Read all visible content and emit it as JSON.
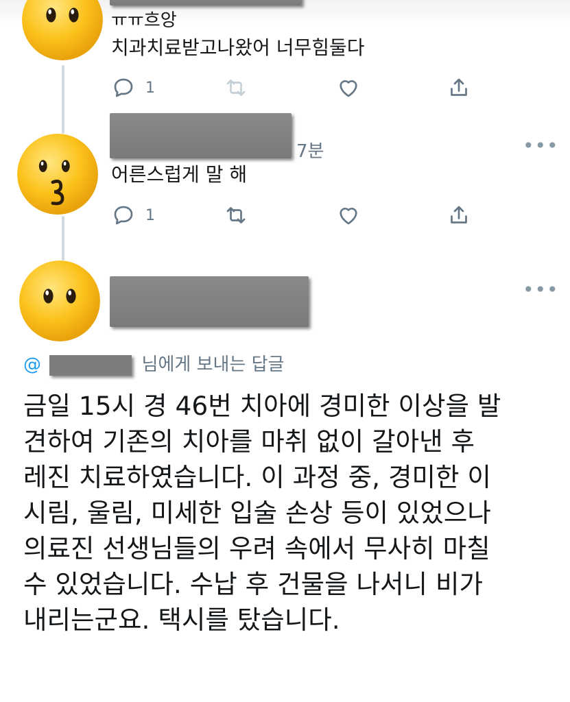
{
  "tweets": [
    {
      "avatar_icon": "emoji-face-neutral-icon",
      "text_lines": [
        "ㅠㅠ흐앙",
        "치과치료받고나왔어 너무힘둘다"
      ],
      "actions": {
        "reply_count": "1",
        "retweet_count": "",
        "like_count": ""
      }
    },
    {
      "avatar_icon": "emoji-face-kissing-icon",
      "time": "7분",
      "text_lines": [
        "어른스럽게 말 해"
      ],
      "actions": {
        "reply_count": "1",
        "retweet_count": "",
        "like_count": ""
      }
    }
  ],
  "focused": {
    "avatar_icon": "emoji-face-neutral-icon",
    "reply_to": {
      "at": "@",
      "suffix": "님에게 보내는 답글"
    },
    "body_lines": [
      "금일 15시 경 46번 치아에 경미한 이상을 발",
      "견하여 기존의 치아를 마취 없이 갈아낸 후",
      "레진 치료하였습니다. 이 과정 중, 경미한 이",
      "시림, 울림, 미세한 입술 손상 등이 있었으나",
      "의료진 선생님들의 우려 속에서 무사히 마칠",
      "수 있었습니다. 수납 후 건물을 나서니 비가",
      "내리는군요. 택시를 탔습니다."
    ]
  },
  "colors": {
    "thread_line": "#cfd9de",
    "icon_gray": "#657786",
    "link_blue": "#1d9bf0"
  }
}
